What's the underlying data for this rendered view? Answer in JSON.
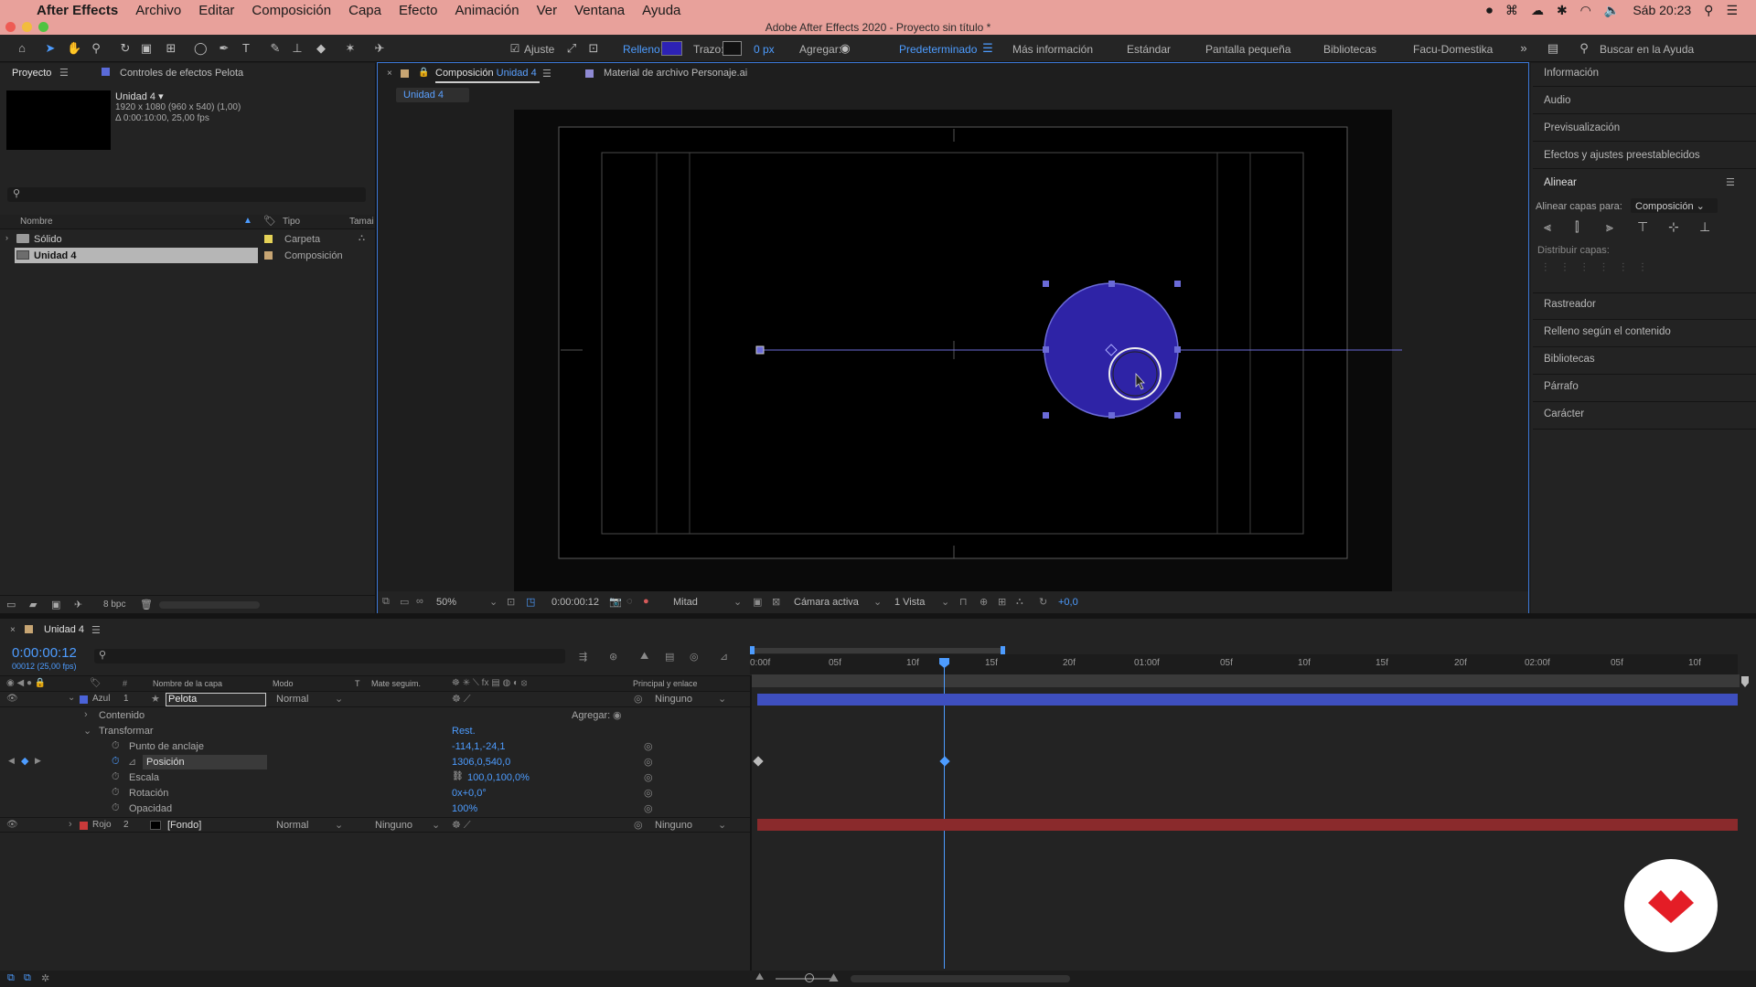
{
  "menubar": {
    "app": "After Effects",
    "items": [
      "Archivo",
      "Editar",
      "Composición",
      "Capa",
      "Efecto",
      "Animación",
      "Ver",
      "Ventana",
      "Ayuda"
    ],
    "clock": "Sáb 20:23"
  },
  "titlebar": {
    "title": "Adobe After Effects 2020 - Proyecto sin título *"
  },
  "toolbar": {
    "snap_label": "Ajuste",
    "fill_label": "Relleno:",
    "stroke_label": "Trazo:",
    "stroke_px": "0 px",
    "add_label": "Agregar:",
    "workspaces": [
      "Predeterminado",
      "Más información",
      "Estándar",
      "Pantalla pequeña",
      "Bibliotecas",
      "Facu-Domestika"
    ],
    "search_placeholder": "Buscar en la Ayuda",
    "fill_color": "#2d22b5"
  },
  "project": {
    "tab_project": "Proyecto",
    "tab_effects": "Controles de efectos Pelota",
    "comp_name": "Unidad 4 ▾",
    "comp_info1": "1920 x 1080  (960 x 540) (1,00)",
    "comp_info2": "Δ 0:00:10:00, 25,00 fps",
    "col_name": "Nombre",
    "col_type": "Tipo",
    "col_size": "Tamai",
    "items": [
      {
        "name": "Sólido",
        "type": "Carpeta",
        "color": "#e5d257"
      },
      {
        "name": "Unidad 4",
        "type": "Composición",
        "color": "#c7a573"
      }
    ],
    "bpc": "8 bpc"
  },
  "viewer": {
    "tab_comp_prefix": "Composición",
    "tab_comp_name": "Unidad 4",
    "tab_footage": "Material de archivo Personaje.ai",
    "sub_tab": "Unidad 4",
    "zoom": "50%",
    "timecode": "0:00:00:12",
    "resolution": "Mitad",
    "camera": "Cámara activa",
    "views": "1 Vista",
    "exposure": "+0,0",
    "ball_color": "#2e23a6"
  },
  "right_panel": {
    "items": [
      "Información",
      "Audio",
      "Previsualización",
      "Efectos y ajustes preestablecidos",
      "Alinear"
    ],
    "align_to_label": "Alinear capas para:",
    "align_to_value": "Composición",
    "distribute_label": "Distribuir capas:",
    "items2": [
      "Rastreador",
      "Relleno según el contenido",
      "Bibliotecas",
      "Párrafo",
      "Carácter"
    ]
  },
  "timeline": {
    "tab": "Unidad 4",
    "timecode": "0:00:00:12",
    "fps": "00012 (25,00 fps)",
    "col_layer_name": "Nombre de la capa",
    "col_mode": "Modo",
    "col_t": "T",
    "col_matte": "Mate seguim.",
    "col_parent": "Principal y enlace",
    "ruler": [
      "0:00f",
      "05f",
      "10f",
      "15f",
      "20f",
      "01:00f",
      "05f",
      "10f",
      "15f",
      "20f",
      "02:00f",
      "05f",
      "10f"
    ],
    "layers": [
      {
        "label": "Azul",
        "num": "1",
        "name": "Pelota",
        "mode": "Normal",
        "parent": "Ninguno",
        "color": "#4b63d8"
      },
      {
        "label": "Rojo",
        "num": "2",
        "name": "[Fondo]",
        "mode": "Normal",
        "matte": "Ninguno",
        "parent": "Ninguno",
        "color": "#c93a3a"
      }
    ],
    "contents": "Contenido",
    "add": "Agregar:",
    "transform": "Transformar",
    "reset": "Rest.",
    "props": [
      {
        "name": "Punto de anclaje",
        "value": "-114,1,-24,1"
      },
      {
        "name": "Posición",
        "value": "1306,0,540,0"
      },
      {
        "name": "Escala",
        "value": "100,0,100,0%"
      },
      {
        "name": "Rotación",
        "value": "0x+0,0°"
      },
      {
        "name": "Opacidad",
        "value": "100%"
      }
    ]
  }
}
